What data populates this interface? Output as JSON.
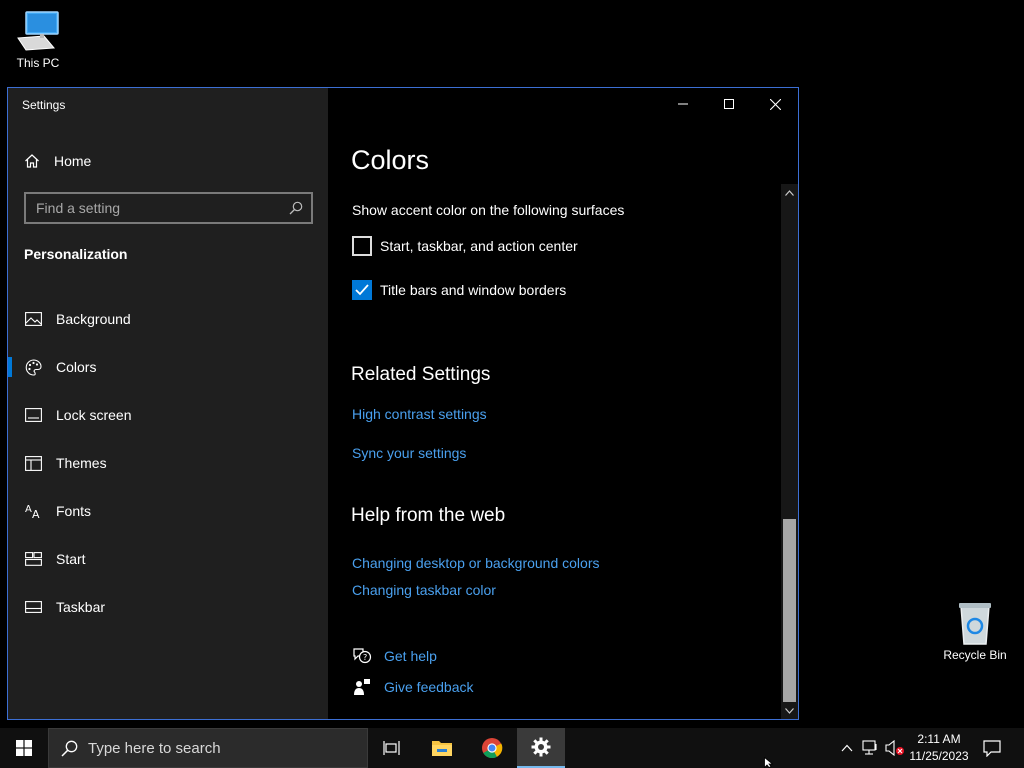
{
  "desktop": {
    "this_pc_label": "This PC",
    "recycle_bin_label": "Recycle Bin"
  },
  "window": {
    "title": "Settings"
  },
  "sidebar": {
    "home_label": "Home",
    "search_placeholder": "Find a setting",
    "section_title": "Personalization",
    "items": [
      {
        "label": "Background",
        "icon": "picture-icon"
      },
      {
        "label": "Colors",
        "icon": "palette-icon",
        "active": true
      },
      {
        "label": "Lock screen",
        "icon": "lock-screen-icon"
      },
      {
        "label": "Themes",
        "icon": "themes-icon"
      },
      {
        "label": "Fonts",
        "icon": "fonts-icon"
      },
      {
        "label": "Start",
        "icon": "start-icon"
      },
      {
        "label": "Taskbar",
        "icon": "taskbar-icon"
      }
    ]
  },
  "content": {
    "title": "Colors",
    "accent_surfaces_label": "Show accent color on the following surfaces",
    "checkbox_start": {
      "label": "Start, taskbar, and action center",
      "checked": false
    },
    "checkbox_title_bars": {
      "label": "Title bars and window borders",
      "checked": true
    },
    "related_heading": "Related Settings",
    "related_links": [
      "High contrast settings",
      "Sync your settings"
    ],
    "help_heading": "Help from the web",
    "help_links": [
      "Changing desktop or background colors",
      "Changing taskbar color"
    ],
    "get_help": "Get help",
    "give_feedback": "Give feedback"
  },
  "taskbar": {
    "search_placeholder": "Type here to search",
    "time": "2:11 AM",
    "date": "11/25/2023"
  },
  "colors": {
    "accent": "#0078d7",
    "link": "#4aa0ee",
    "sidebar_bg": "#1f1f1f",
    "window_border": "#3c6fd4"
  }
}
